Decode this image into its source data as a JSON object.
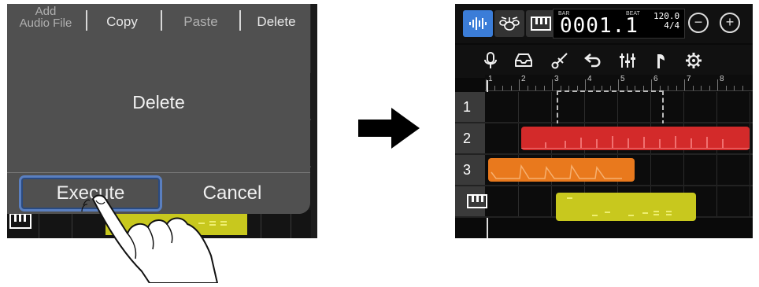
{
  "left_screen": {
    "menu": {
      "add_line1": "Add",
      "add_line2": "Audio File",
      "copy": "Copy",
      "paste": "Paste",
      "delete": "Delete"
    },
    "dialog": {
      "title": "Delete",
      "execute": "Execute",
      "cancel": "Cancel"
    },
    "colors": {
      "dialog_bg": "#505050",
      "execute_outline": "#5a7fc0",
      "yellow_region": "#c8c81e"
    }
  },
  "arrow": {
    "direction": "right",
    "color": "#000000"
  },
  "right_screen": {
    "toolbar1": {
      "icons": [
        "waveform-icon",
        "drum-kit-icon",
        "keyboard-icon"
      ],
      "counter_label_left": "BAR",
      "counter_label_right": "BEAT",
      "counter": "0001.1",
      "tempo": "120.0",
      "time_signature": "4/4",
      "zoom_out": "−",
      "zoom_in": "+"
    },
    "toolbar2": {
      "icons": [
        "microphone-icon",
        "inbox-icon",
        "scissors-icon",
        "undo-icon",
        "mixer-icon",
        "metronome-icon",
        "settings-icon"
      ]
    },
    "ruler": [
      "1",
      "2",
      "3",
      "4",
      "5",
      "6",
      "7",
      "8"
    ],
    "tracks": [
      {
        "label": "1"
      },
      {
        "label": "2"
      },
      {
        "label": "3"
      },
      {
        "label": "keyboard"
      }
    ],
    "colors": {
      "active_tab": "#3b7dd8",
      "track2_region": "#d32a2a",
      "track3_region": "#e9791d",
      "track4_region": "#c8c81e"
    }
  }
}
